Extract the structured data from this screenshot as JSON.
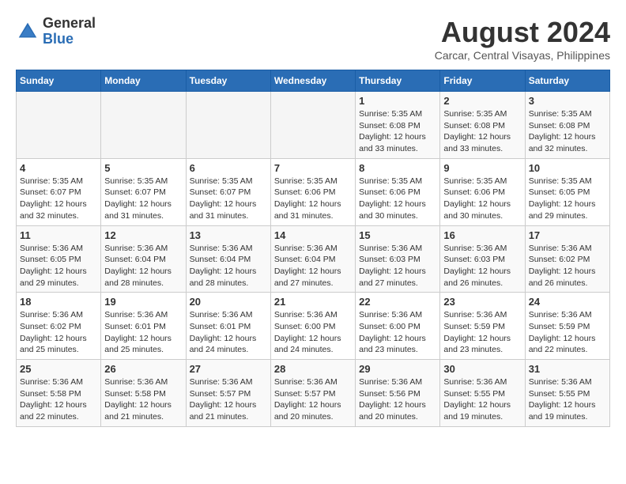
{
  "header": {
    "logo_general": "General",
    "logo_blue": "Blue",
    "month_title": "August 2024",
    "location": "Carcar, Central Visayas, Philippines"
  },
  "days_of_week": [
    "Sunday",
    "Monday",
    "Tuesday",
    "Wednesday",
    "Thursday",
    "Friday",
    "Saturday"
  ],
  "weeks": [
    [
      {
        "day": "",
        "info": ""
      },
      {
        "day": "",
        "info": ""
      },
      {
        "day": "",
        "info": ""
      },
      {
        "day": "",
        "info": ""
      },
      {
        "day": "1",
        "info": "Sunrise: 5:35 AM\nSunset: 6:08 PM\nDaylight: 12 hours\nand 33 minutes."
      },
      {
        "day": "2",
        "info": "Sunrise: 5:35 AM\nSunset: 6:08 PM\nDaylight: 12 hours\nand 33 minutes."
      },
      {
        "day": "3",
        "info": "Sunrise: 5:35 AM\nSunset: 6:08 PM\nDaylight: 12 hours\nand 32 minutes."
      }
    ],
    [
      {
        "day": "4",
        "info": "Sunrise: 5:35 AM\nSunset: 6:07 PM\nDaylight: 12 hours\nand 32 minutes."
      },
      {
        "day": "5",
        "info": "Sunrise: 5:35 AM\nSunset: 6:07 PM\nDaylight: 12 hours\nand 31 minutes."
      },
      {
        "day": "6",
        "info": "Sunrise: 5:35 AM\nSunset: 6:07 PM\nDaylight: 12 hours\nand 31 minutes."
      },
      {
        "day": "7",
        "info": "Sunrise: 5:35 AM\nSunset: 6:06 PM\nDaylight: 12 hours\nand 31 minutes."
      },
      {
        "day": "8",
        "info": "Sunrise: 5:35 AM\nSunset: 6:06 PM\nDaylight: 12 hours\nand 30 minutes."
      },
      {
        "day": "9",
        "info": "Sunrise: 5:35 AM\nSunset: 6:06 PM\nDaylight: 12 hours\nand 30 minutes."
      },
      {
        "day": "10",
        "info": "Sunrise: 5:35 AM\nSunset: 6:05 PM\nDaylight: 12 hours\nand 29 minutes."
      }
    ],
    [
      {
        "day": "11",
        "info": "Sunrise: 5:36 AM\nSunset: 6:05 PM\nDaylight: 12 hours\nand 29 minutes."
      },
      {
        "day": "12",
        "info": "Sunrise: 5:36 AM\nSunset: 6:04 PM\nDaylight: 12 hours\nand 28 minutes."
      },
      {
        "day": "13",
        "info": "Sunrise: 5:36 AM\nSunset: 6:04 PM\nDaylight: 12 hours\nand 28 minutes."
      },
      {
        "day": "14",
        "info": "Sunrise: 5:36 AM\nSunset: 6:04 PM\nDaylight: 12 hours\nand 27 minutes."
      },
      {
        "day": "15",
        "info": "Sunrise: 5:36 AM\nSunset: 6:03 PM\nDaylight: 12 hours\nand 27 minutes."
      },
      {
        "day": "16",
        "info": "Sunrise: 5:36 AM\nSunset: 6:03 PM\nDaylight: 12 hours\nand 26 minutes."
      },
      {
        "day": "17",
        "info": "Sunrise: 5:36 AM\nSunset: 6:02 PM\nDaylight: 12 hours\nand 26 minutes."
      }
    ],
    [
      {
        "day": "18",
        "info": "Sunrise: 5:36 AM\nSunset: 6:02 PM\nDaylight: 12 hours\nand 25 minutes."
      },
      {
        "day": "19",
        "info": "Sunrise: 5:36 AM\nSunset: 6:01 PM\nDaylight: 12 hours\nand 25 minutes."
      },
      {
        "day": "20",
        "info": "Sunrise: 5:36 AM\nSunset: 6:01 PM\nDaylight: 12 hours\nand 24 minutes."
      },
      {
        "day": "21",
        "info": "Sunrise: 5:36 AM\nSunset: 6:00 PM\nDaylight: 12 hours\nand 24 minutes."
      },
      {
        "day": "22",
        "info": "Sunrise: 5:36 AM\nSunset: 6:00 PM\nDaylight: 12 hours\nand 23 minutes."
      },
      {
        "day": "23",
        "info": "Sunrise: 5:36 AM\nSunset: 5:59 PM\nDaylight: 12 hours\nand 23 minutes."
      },
      {
        "day": "24",
        "info": "Sunrise: 5:36 AM\nSunset: 5:59 PM\nDaylight: 12 hours\nand 22 minutes."
      }
    ],
    [
      {
        "day": "25",
        "info": "Sunrise: 5:36 AM\nSunset: 5:58 PM\nDaylight: 12 hours\nand 22 minutes."
      },
      {
        "day": "26",
        "info": "Sunrise: 5:36 AM\nSunset: 5:58 PM\nDaylight: 12 hours\nand 21 minutes."
      },
      {
        "day": "27",
        "info": "Sunrise: 5:36 AM\nSunset: 5:57 PM\nDaylight: 12 hours\nand 21 minutes."
      },
      {
        "day": "28",
        "info": "Sunrise: 5:36 AM\nSunset: 5:57 PM\nDaylight: 12 hours\nand 20 minutes."
      },
      {
        "day": "29",
        "info": "Sunrise: 5:36 AM\nSunset: 5:56 PM\nDaylight: 12 hours\nand 20 minutes."
      },
      {
        "day": "30",
        "info": "Sunrise: 5:36 AM\nSunset: 5:55 PM\nDaylight: 12 hours\nand 19 minutes."
      },
      {
        "day": "31",
        "info": "Sunrise: 5:36 AM\nSunset: 5:55 PM\nDaylight: 12 hours\nand 19 minutes."
      }
    ]
  ]
}
